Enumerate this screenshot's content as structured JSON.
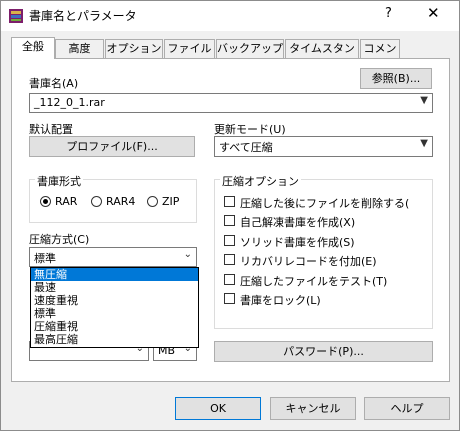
{
  "window": {
    "title": "書庫名とパラメータ",
    "help_glyph": "?",
    "close_glyph": "✕"
  },
  "tabs": [
    {
      "label": "全般",
      "active": true
    },
    {
      "label": "高度"
    },
    {
      "label": "オプション"
    },
    {
      "label": "ファイル"
    },
    {
      "label": "バックアップ"
    },
    {
      "label": "タイムスタンプ"
    },
    {
      "label": "コメント"
    }
  ],
  "archive_name": {
    "label": "書庫名(A)",
    "value": "_112_0_1.rar",
    "browse_label": "参照(B)..."
  },
  "default_profile": {
    "label": "默认配置",
    "button_label": "プロファイル(F)..."
  },
  "update_mode": {
    "label": "更新モード(U)",
    "value": "すべて圧縮"
  },
  "archive_format": {
    "title": "書庫形式",
    "options": [
      {
        "label": "RAR",
        "selected": true
      },
      {
        "label": "RAR4"
      },
      {
        "label": "ZIP"
      }
    ]
  },
  "compression_method": {
    "label": "圧縮方式(C)",
    "value": "標準",
    "options": [
      "無圧縮",
      "最速",
      "速度重視",
      "標準",
      "圧縮重視",
      "最高圧縮"
    ],
    "highlighted": "無圧縮"
  },
  "split": {
    "unit": "MB"
  },
  "compression_options": {
    "title": "圧縮オプション",
    "items": [
      "圧縮した後にファイルを削除する(",
      "自己解凍書庫を作成(X)",
      "ソリッド書庫を作成(S)",
      "リカバリレコードを付加(E)",
      "圧縮したファイルをテスト(T)",
      "書庫をロック(L)"
    ]
  },
  "password_label": "パスワード(P)...",
  "buttons": {
    "ok": "OK",
    "cancel": "キャンセル",
    "help": "ヘルプ"
  }
}
